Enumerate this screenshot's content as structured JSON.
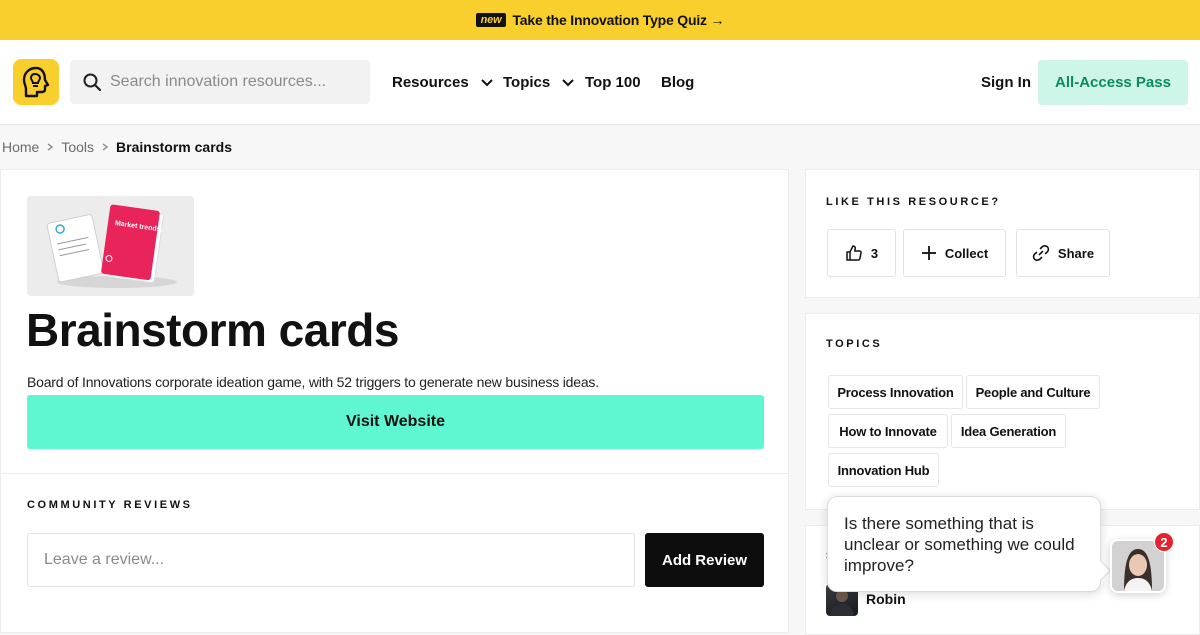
{
  "banner": {
    "badge": "new",
    "text": "Take the Innovation Type Quiz →"
  },
  "nav": {
    "search_placeholder": "Search innovation resources...",
    "menu": [
      {
        "label": "Resources",
        "has_dropdown": true
      },
      {
        "label": "Topics",
        "has_dropdown": true
      },
      {
        "label": "Top 100",
        "has_dropdown": false
      },
      {
        "label": "Blog",
        "has_dropdown": false
      }
    ],
    "sign_in": "Sign In",
    "pass": "All-Access Pass"
  },
  "breadcrumb": {
    "items": [
      "Home",
      "Tools"
    ],
    "current": "Brainstorm cards"
  },
  "resource": {
    "title": "Brainstorm cards",
    "description": "Board of Innovations corporate ideation game, with 52 triggers to generate new business ideas.",
    "visit_label": "Visit Website",
    "card_text": "Market trends."
  },
  "reviews": {
    "label": "COMMUNITY REVIEWS",
    "input_placeholder": "Leave a review...",
    "add_label": "Add Review"
  },
  "like": {
    "label": "LIKE THIS RESOURCE?",
    "likes": "3",
    "collect": "Collect",
    "share": "Share"
  },
  "topics": {
    "label": "TOPICS",
    "tags": [
      "Process Innovation",
      "People and Culture",
      "How to Innovate",
      "Idea Generation",
      "Innovation Hub"
    ]
  },
  "submitted": {
    "label": "S",
    "name": "Robin"
  },
  "chat": {
    "message": "Is there something that is unclear or something we could improve?",
    "unread": "2"
  },
  "colors": {
    "banner": "#f9cf2e",
    "accent_mint": "#5ff7d2",
    "pass_bg": "#cdf6e8",
    "pass_text": "#0c8a62",
    "dark": "#0d0d0d"
  },
  "icons": [
    "head-lightbulb-logo",
    "search-icon",
    "chevron-down-icon",
    "chevron-right-icon",
    "thumbs-up-icon",
    "plus-icon",
    "link-icon"
  ]
}
